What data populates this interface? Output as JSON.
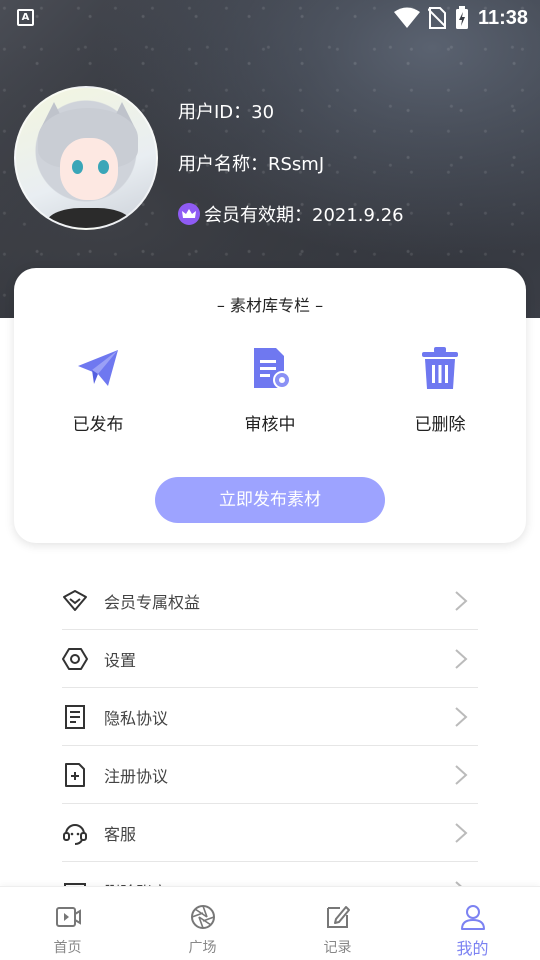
{
  "status_bar": {
    "time": "11:38",
    "app_badge": "A"
  },
  "profile": {
    "user_id_label": "用户ID：30",
    "user_name_label": "用户名称：RSsmJ",
    "vip_label": "会员有效期：2021.9.26"
  },
  "material_card": {
    "title": "– 素材库专栏 –",
    "items": [
      {
        "label": "已发布",
        "icon": "paper-plane-icon"
      },
      {
        "label": "审核中",
        "icon": "document-review-icon"
      },
      {
        "label": "已删除",
        "icon": "trash-icon"
      }
    ],
    "publish_button": "立即发布素材"
  },
  "menu": [
    {
      "label": "会员专属权益",
      "icon": "diamond-icon"
    },
    {
      "label": "设置",
      "icon": "hexagon-settings-icon"
    },
    {
      "label": "隐私协议",
      "icon": "document-icon"
    },
    {
      "label": "注册协议",
      "icon": "document-plus-icon"
    },
    {
      "label": "客服",
      "icon": "headset-icon"
    },
    {
      "label": "删除账户",
      "icon": "delete-account-icon"
    }
  ],
  "bottom_nav": [
    {
      "label": "首页",
      "icon": "video-icon",
      "active": false
    },
    {
      "label": "广场",
      "icon": "aperture-icon",
      "active": false
    },
    {
      "label": "记录",
      "icon": "edit-icon",
      "active": false
    },
    {
      "label": "我的",
      "icon": "user-icon",
      "active": true
    }
  ],
  "colors": {
    "accent": "#7c82f2",
    "button": "#9da3ff",
    "icon_blue": "#6f78f0",
    "crown": "#8f5bf4"
  }
}
